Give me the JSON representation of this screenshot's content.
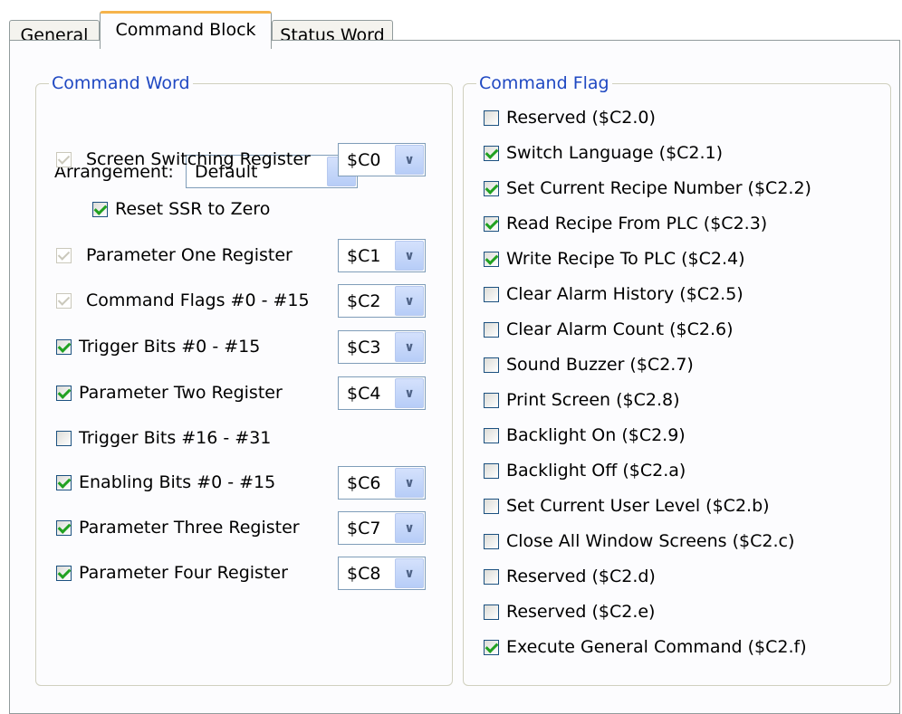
{
  "tabs": [
    "General",
    "Command Block",
    "Status Word"
  ],
  "command_word": {
    "title": "Command Word",
    "arrangement_label": "Arrangement:",
    "arrangement_value": "Default",
    "rows": [
      {
        "label": "Screen Switching Register",
        "checked": true,
        "disabled": true,
        "register": "$C0"
      },
      {
        "label": "Reset SSR to Zero",
        "checked": true,
        "disabled": false,
        "register": null
      },
      {
        "label": "Parameter One Register",
        "checked": true,
        "disabled": true,
        "register": "$C1"
      },
      {
        "label": "Command Flags #0 - #15",
        "checked": true,
        "disabled": true,
        "register": "$C2"
      },
      {
        "label": "Trigger Bits #0 - #15",
        "checked": true,
        "disabled": false,
        "register": "$C3"
      },
      {
        "label": "Parameter Two Register",
        "checked": true,
        "disabled": false,
        "register": "$C4"
      },
      {
        "label": "Trigger Bits #16 - #31",
        "checked": false,
        "disabled": false,
        "register": null
      },
      {
        "label": "Enabling Bits #0 - #15",
        "checked": true,
        "disabled": false,
        "register": "$C6"
      },
      {
        "label": "Parameter Three Register",
        "checked": true,
        "disabled": false,
        "register": "$C7"
      },
      {
        "label": "Parameter Four Register",
        "checked": true,
        "disabled": false,
        "register": "$C8"
      }
    ]
  },
  "command_flag": {
    "title": "Command Flag",
    "items": [
      {
        "label": "Reserved ($C2.0)",
        "checked": false
      },
      {
        "label": "Switch Language ($C2.1)",
        "checked": true
      },
      {
        "label": "Set Current Recipe Number ($C2.2)",
        "checked": true
      },
      {
        "label": "Read Recipe From PLC ($C2.3)",
        "checked": true
      },
      {
        "label": "Write Recipe To PLC ($C2.4)",
        "checked": true
      },
      {
        "label": "Clear Alarm History ($C2.5)",
        "checked": false
      },
      {
        "label": "Clear Alarm Count ($C2.6)",
        "checked": false
      },
      {
        "label": "Sound Buzzer ($C2.7)",
        "checked": false
      },
      {
        "label": "Print Screen ($C2.8)",
        "checked": false
      },
      {
        "label": "Backlight On ($C2.9)",
        "checked": false
      },
      {
        "label": "Backlight Off ($C2.a)",
        "checked": false
      },
      {
        "label": "Set Current User Level ($C2.b)",
        "checked": false
      },
      {
        "label": "Close All Window Screens ($C2.c)",
        "checked": false
      },
      {
        "label": "Reserved ($C2.d)",
        "checked": false
      },
      {
        "label": "Reserved ($C2.e)",
        "checked": false
      },
      {
        "label": "Execute General Command ($C2.f)",
        "checked": true
      }
    ]
  },
  "icons": {
    "dropdown": "chevron-down-icon",
    "check": "check-icon"
  },
  "colors": {
    "group_title": "#1f48c2",
    "tab_highlight": "#f5b34b",
    "check_mark": "#21a121"
  }
}
